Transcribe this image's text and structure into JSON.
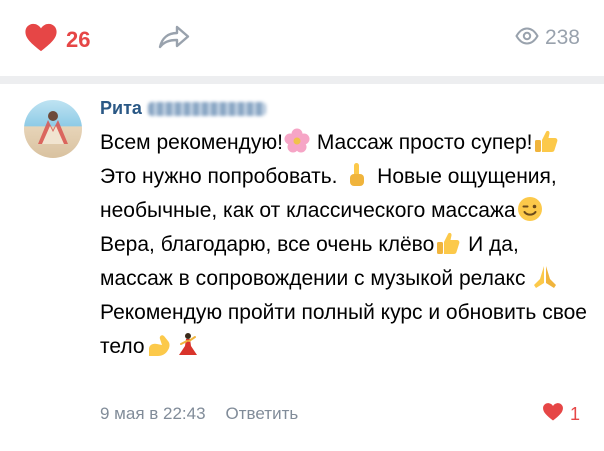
{
  "post_actions": {
    "like_count": "26",
    "view_count": "238",
    "like_color": "#e64646",
    "icons": [
      "heart-icon",
      "share-arrow-icon",
      "eye-icon"
    ]
  },
  "comment": {
    "author_first_name": "Рита",
    "author_last_name": "Кириллова",
    "text_segments": [
      "Всем рекомендую!",
      " Массаж просто супер!",
      " Это нужно попробовать. ",
      " Новые ощущения, необычные, как от классического массажа",
      " Вера, благодарю, все очень клёво",
      " И да, массаж в сопровождении с музыкой релакс ",
      " Рекомендую пройти полный курс и обновить свое тело"
    ],
    "emojis": [
      "blossom-emoji",
      "thumbs-up-emoji",
      "pointing-up-emoji",
      "winking-face-emoji",
      "thumbs-up-emoji",
      "praying-hands-emoji",
      "flexed-biceps-emoji",
      "flamenco-dancer-emoji"
    ],
    "date": "9 мая в 22:43",
    "reply_label": "Ответить",
    "like_count": "1"
  }
}
